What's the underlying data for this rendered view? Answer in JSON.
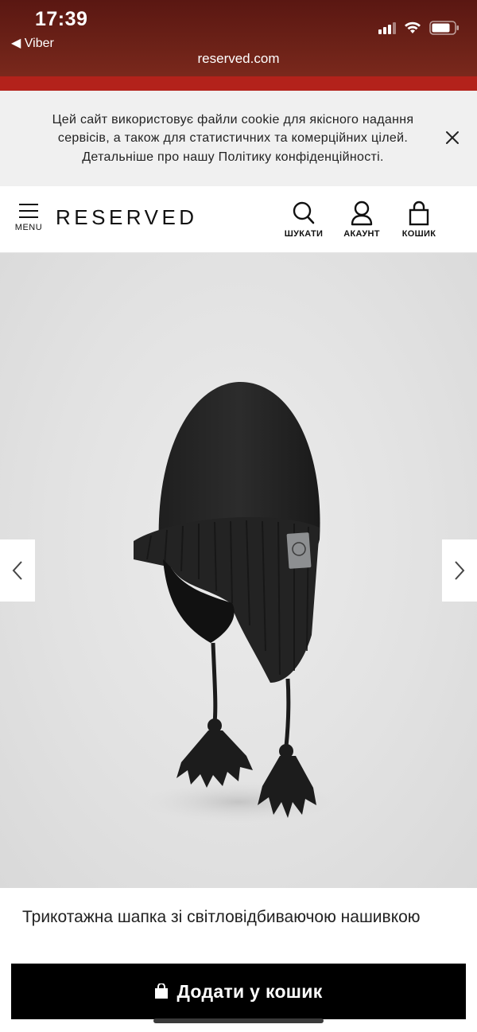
{
  "status_bar": {
    "time": "17:39",
    "back_label": "◀ Viber"
  },
  "browser": {
    "url": "reserved.com"
  },
  "cookie_banner": {
    "text": "Цей сайт використовує файли cookie для якісного надання сервісів, а також для статистичних та комерційних цілей. Детальніше про нашу Політику конфіденційності.",
    "close_icon": "close-icon"
  },
  "header": {
    "menu_label": "MENU",
    "logo": "RESERVED",
    "search_label": "ШУКАТИ",
    "account_label": "АКАУНТ",
    "cart_label": "КОШИК"
  },
  "product": {
    "title": "Трикотажна шапка зі світловідбиваючою нашивкою",
    "add_to_cart_label": "Додати у кошик"
  },
  "colors": {
    "status_bg": "#6d2218",
    "accent_red": "#b3221b",
    "cookie_bg": "#f0f0f0",
    "button_bg": "#000000"
  }
}
